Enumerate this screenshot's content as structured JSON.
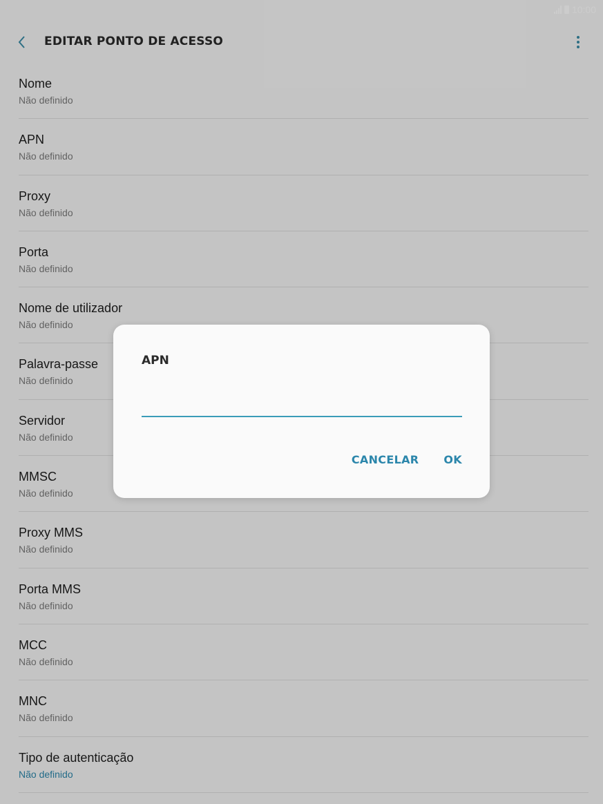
{
  "status_bar": {
    "time": "10:00",
    "signal_icon": "signal-icon",
    "battery_icon": "battery-icon"
  },
  "app_bar": {
    "title": "EDITAR PONTO DE ACESSO",
    "back_icon": "chevron-left-icon",
    "menu_icon": "more-vert-icon"
  },
  "settings": [
    {
      "title": "Nome",
      "value": "Não definido"
    },
    {
      "title": "APN",
      "value": "Não definido"
    },
    {
      "title": "Proxy",
      "value": "Não definido"
    },
    {
      "title": "Porta",
      "value": "Não definido"
    },
    {
      "title": "Nome de utilizador",
      "value": "Não definido"
    },
    {
      "title": "Palavra-passe",
      "value": "Não definido"
    },
    {
      "title": "Servidor",
      "value": "Não definido"
    },
    {
      "title": "MMSC",
      "value": "Não definido"
    },
    {
      "title": "Proxy MMS",
      "value": "Não definido"
    },
    {
      "title": "Porta MMS",
      "value": "Não definido"
    },
    {
      "title": "MCC",
      "value": "Não definido"
    },
    {
      "title": "MNC",
      "value": "Não definido"
    },
    {
      "title": "Tipo de autenticação",
      "value": "Não definido"
    }
  ],
  "dialog": {
    "title": "APN",
    "input_value": "",
    "cancel_label": "CANCELAR",
    "ok_label": "OK"
  },
  "colors": {
    "accent": "#2b86ab",
    "scrim": "rgba(0,0,0,0.20)",
    "background": "#f6f6f6"
  }
}
